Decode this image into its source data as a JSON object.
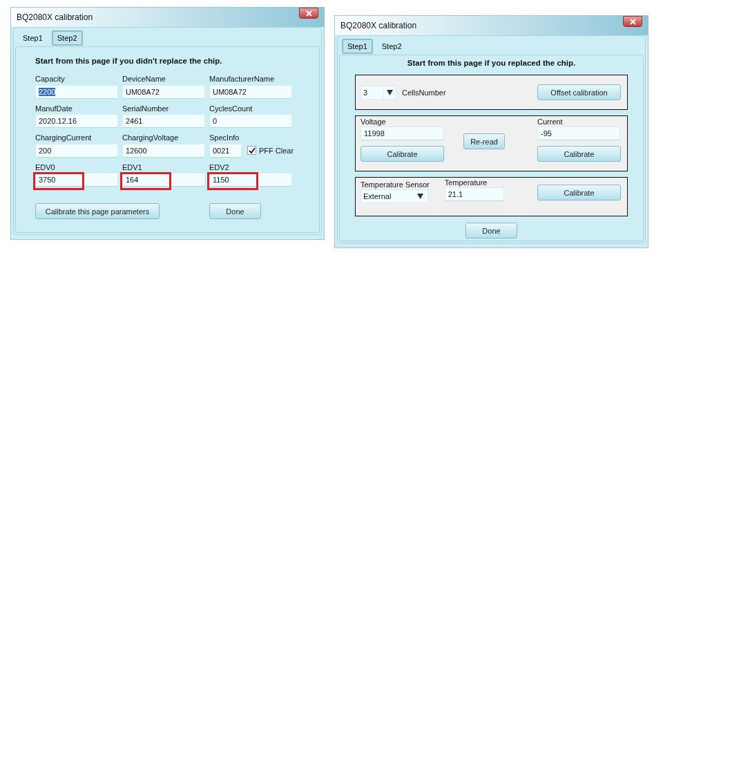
{
  "windows": [
    {
      "kind": "parameters",
      "title": "BQ2080X calibration",
      "tabs": [
        {
          "label": "Step1",
          "selected": false
        },
        {
          "label": "Step2",
          "selected": true
        }
      ],
      "heading": "Start from this page if you didn't replace the chip.",
      "fields": [
        {
          "label": "Capacity",
          "value": "2200",
          "text_selected": true
        },
        {
          "label": "DeviceName",
          "value": "UM08A72"
        },
        {
          "label": "ManufacturerName",
          "value": "UM08A72"
        },
        {
          "label": "ManufDate",
          "value": "2020.12.16"
        },
        {
          "label": "SerialNumber",
          "value": "2461"
        },
        {
          "label": "CyclesCount",
          "value": "0"
        },
        {
          "label": "ChargingCurrent",
          "value": "200"
        },
        {
          "label": "ChargingVoltage",
          "value": "12600"
        },
        {
          "label": "SpecInfo",
          "value": "0021",
          "checkbox": {
            "label": "PFF Clear",
            "checked": true
          }
        },
        {
          "label": "EDV0",
          "value": "3750",
          "highlighted": true
        },
        {
          "label": "EDV1",
          "value": "164",
          "highlighted": true
        },
        {
          "label": "EDV2",
          "value": "1150",
          "highlighted": true
        }
      ],
      "buttons": [
        "Calibrate this page parameters",
        "Done"
      ]
    },
    {
      "kind": "calibration",
      "title": "BQ2080X calibration",
      "tabs": [
        {
          "label": "Step1",
          "selected": true
        },
        {
          "label": "Step2",
          "selected": false
        }
      ],
      "heading": "Start from this page if you replaced the chip.",
      "sections": [
        {
          "kind": "cells",
          "select": "3",
          "label": "CellsNumber",
          "button": "Offset calibration"
        },
        {
          "kind": "readings",
          "left": {
            "label": "Voltage",
            "value": "11998",
            "button": "Calibrate"
          },
          "middle_button": "Re-read",
          "right": {
            "label": "Current",
            "value": "-95",
            "button": "Calibrate"
          }
        },
        {
          "kind": "temperature",
          "sensor": {
            "label": "Temperature Sensor",
            "value": "External"
          },
          "reading": {
            "label": "Temperature",
            "value": "21.1"
          },
          "button": "Calibrate"
        }
      ],
      "buttons": [
        "Done"
      ]
    }
  ]
}
